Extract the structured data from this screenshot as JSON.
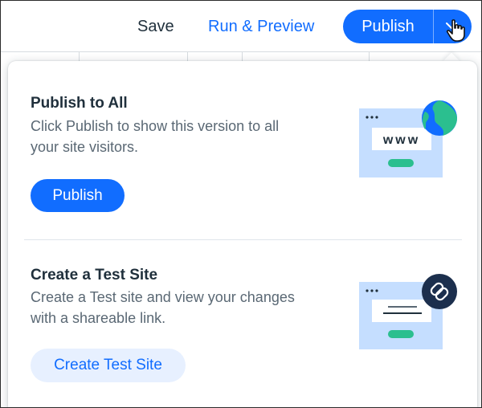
{
  "topbar": {
    "save_label": "Save",
    "preview_label": "Run & Preview",
    "publish_label": "Publish"
  },
  "popover": {
    "publish_section": {
      "title": "Publish to All",
      "description": "Click Publish to show this version to all your site visitors.",
      "button_label": "Publish",
      "illustration_text": "www"
    },
    "test_site_section": {
      "title": "Create a Test Site",
      "description": "Create a Test site and view your changes with a shareable link.",
      "button_label": "Create Test Site"
    }
  },
  "colors": {
    "accent": "#116dff",
    "accent_light": "#e7f0ff",
    "illustration_bg": "#c5deff",
    "illustration_green": "#2bbf8f",
    "text_dark": "#20303c",
    "text_muted": "#5a6874"
  },
  "icons": [
    "chevron-down-icon",
    "hand-cursor-icon",
    "globe-icon",
    "link-icon"
  ]
}
